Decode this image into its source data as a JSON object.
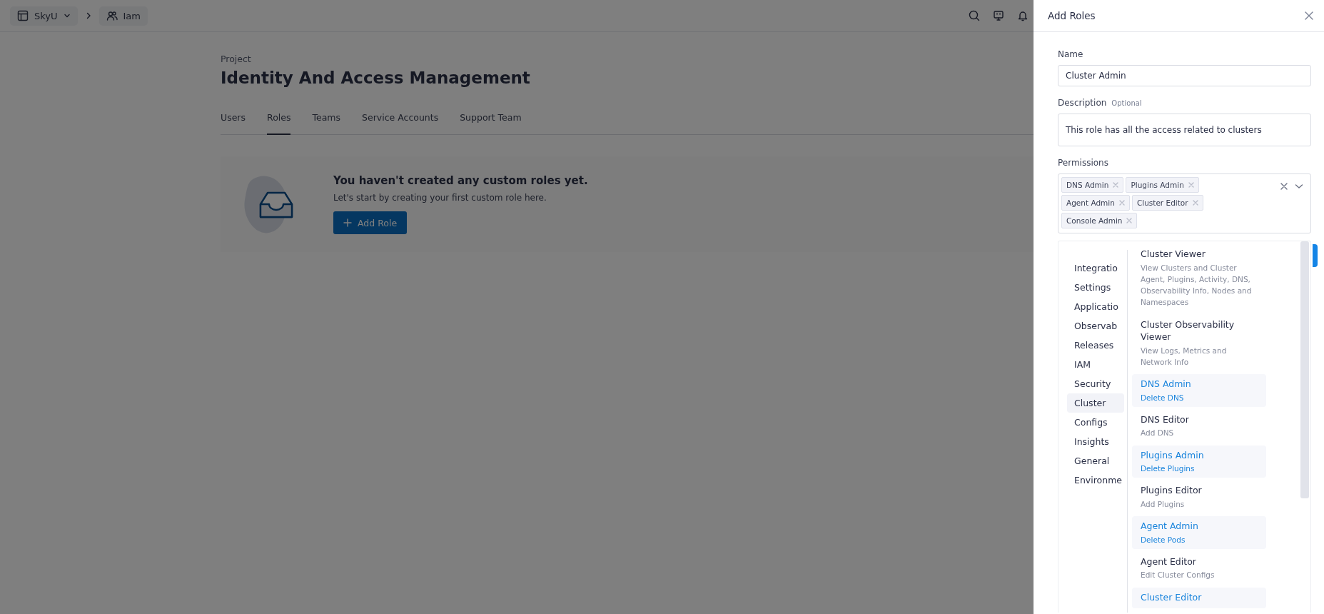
{
  "topbar": {
    "breadcrumbs": [
      {
        "label": "SkyU",
        "kind": "org"
      },
      {
        "label": "Iam",
        "kind": "team"
      }
    ]
  },
  "page": {
    "eyebrow": "Project",
    "title": "Identity And Access Management",
    "tabs": [
      {
        "label": "Users",
        "selected": false
      },
      {
        "label": "Roles",
        "selected": true
      },
      {
        "label": "Teams",
        "selected": false
      },
      {
        "label": "Service Accounts",
        "selected": false
      },
      {
        "label": "Support Team",
        "selected": false
      }
    ],
    "empty_state": {
      "title": "You haven't created any custom roles yet.",
      "text": "Let's start by creating your first custom role here.",
      "button": "Add Role"
    }
  },
  "drawer": {
    "title": "Add Roles",
    "name": {
      "label": "Name",
      "value": "Cluster Admin"
    },
    "description": {
      "label": "Description",
      "hint": "Optional",
      "value": "This role has all the access related to clusters"
    },
    "permissions": {
      "label": "Permissions",
      "tags": [
        "DNS Admin",
        "Plugins Admin",
        "Agent Admin",
        "Cluster Editor",
        "Console Admin"
      ]
    },
    "categories": [
      {
        "label": "Integratio",
        "selected": false
      },
      {
        "label": "Settings",
        "selected": false
      },
      {
        "label": "Applicatio",
        "selected": false
      },
      {
        "label": "Observab",
        "selected": false
      },
      {
        "label": "Releases",
        "selected": false
      },
      {
        "label": "IAM",
        "selected": false
      },
      {
        "label": "Security",
        "selected": false
      },
      {
        "label": "Cluster",
        "selected": true
      },
      {
        "label": "Configs",
        "selected": false
      },
      {
        "label": "Insights",
        "selected": false
      },
      {
        "label": "General",
        "selected": false
      },
      {
        "label": "Environme",
        "selected": false
      }
    ],
    "roles": [
      {
        "name": "Cluster Viewer",
        "description": "View Clusters and Cluster Agent, Plugins, Activity, DNS, Observability Info, Nodes and Namespaces",
        "selected": false
      },
      {
        "name": "Cluster Observability Viewer",
        "description": "View Logs, Metrics and Network Info",
        "selected": false
      },
      {
        "name": "DNS Admin",
        "description": "Delete DNS",
        "selected": true
      },
      {
        "name": "DNS Editor",
        "description": "Add DNS",
        "selected": false
      },
      {
        "name": "Plugins Admin",
        "description": "Delete Plugins",
        "selected": true
      },
      {
        "name": "Plugins Editor",
        "description": "Add Plugins",
        "selected": false
      },
      {
        "name": "Agent Admin",
        "description": "Delete Pods",
        "selected": true
      },
      {
        "name": "Agent Editor",
        "description": "Edit Cluster Configs",
        "selected": false
      },
      {
        "name": "Cluster Editor",
        "selected": true
      }
    ]
  }
}
